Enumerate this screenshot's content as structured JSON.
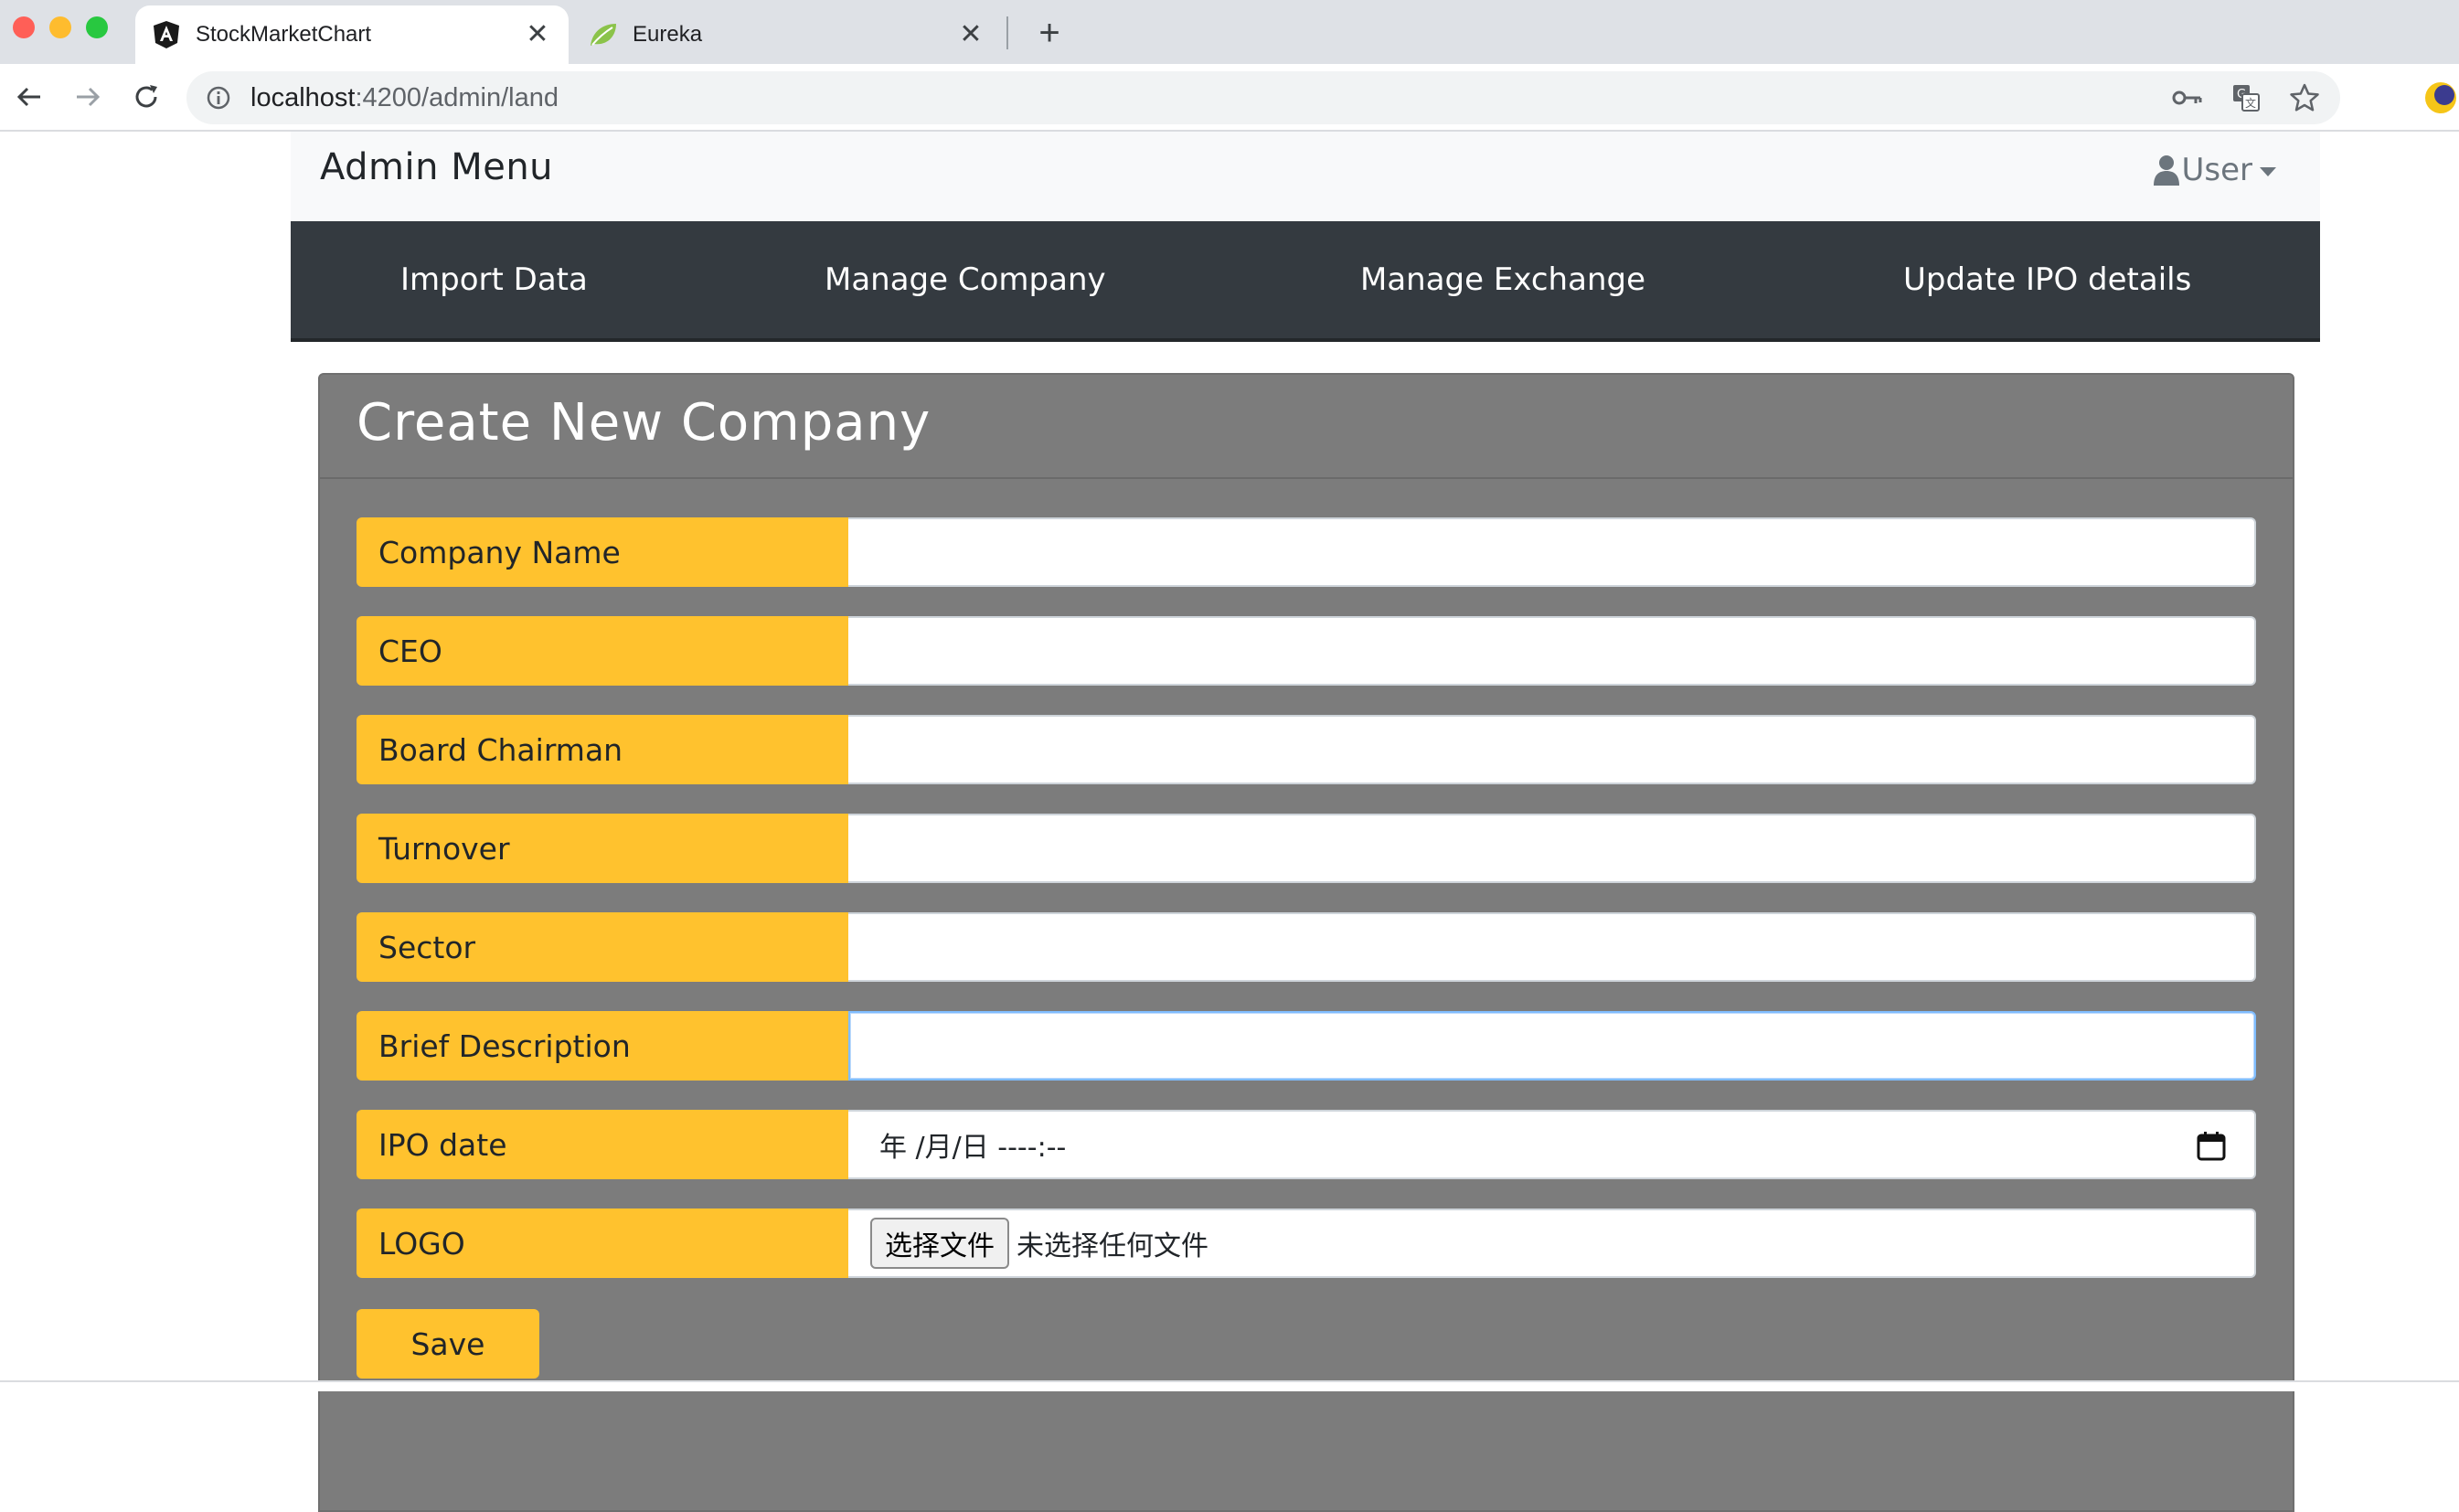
{
  "browser": {
    "tabs": [
      {
        "title": "StockMarketChart",
        "favicon": "angular-icon",
        "active": true
      },
      {
        "title": "Eureka",
        "favicon": "spring-leaf-icon",
        "active": false
      }
    ],
    "url_host": "localhost",
    "url_path": ":4200/admin/land"
  },
  "header": {
    "title": "Admin Menu",
    "user_label": "User"
  },
  "nav": {
    "items": [
      {
        "label": "Import Data"
      },
      {
        "label": "Manage Company"
      },
      {
        "label": "Manage Exchange"
      },
      {
        "label": "Update IPO details"
      }
    ]
  },
  "form": {
    "title": "Create New Company",
    "fields": [
      {
        "label": "Company Name",
        "value": ""
      },
      {
        "label": "CEO",
        "value": ""
      },
      {
        "label": "Board Chairman",
        "value": ""
      },
      {
        "label": "Turnover",
        "value": ""
      },
      {
        "label": "Sector",
        "value": ""
      },
      {
        "label": "Brief Description",
        "value": ""
      },
      {
        "label": "IPO date",
        "placeholder": "年 /月/日 --‐‐:‐‐"
      },
      {
        "label": "LOGO",
        "button_label": "选择文件",
        "status": "未选择任何文件"
      }
    ],
    "save_label": "Save"
  },
  "colors": {
    "label_bg": "#ffc22e",
    "nav_bg": "#343a40",
    "card_bg": "#7c7c7c",
    "header_bg": "#f8f9fa"
  }
}
